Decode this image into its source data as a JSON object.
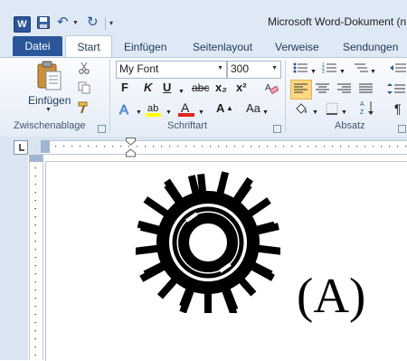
{
  "window": {
    "title": "Microsoft Word-Dokument (n"
  },
  "qat": {
    "app_icon_letter": "W"
  },
  "tabs": [
    {
      "id": "file",
      "label": "Datei"
    },
    {
      "id": "start",
      "label": "Start"
    },
    {
      "id": "insert",
      "label": "Einfügen"
    },
    {
      "id": "layout",
      "label": "Seitenlayout"
    },
    {
      "id": "refs",
      "label": "Verweise"
    },
    {
      "id": "mailings",
      "label": "Sendungen"
    }
  ],
  "ribbon": {
    "clipboard": {
      "paste_label": "Einfügen",
      "group_label": "Zwischenablage"
    },
    "font": {
      "group_label": "Schriftart",
      "font_name": "My Font",
      "font_size": "300",
      "bold": "F",
      "italic": "K",
      "underline": "U",
      "strike": "abc",
      "subscript": "x₂",
      "superscript": "x²",
      "grow": "A",
      "case": "Aa"
    },
    "paragraph": {
      "group_label": "Absatz"
    }
  },
  "document": {
    "caption": "(A)"
  },
  "colors": {
    "file_tab": "#2b579a",
    "highlight": "#ffff00",
    "font_color": "#e2231a",
    "active_align": "#fcd982"
  }
}
